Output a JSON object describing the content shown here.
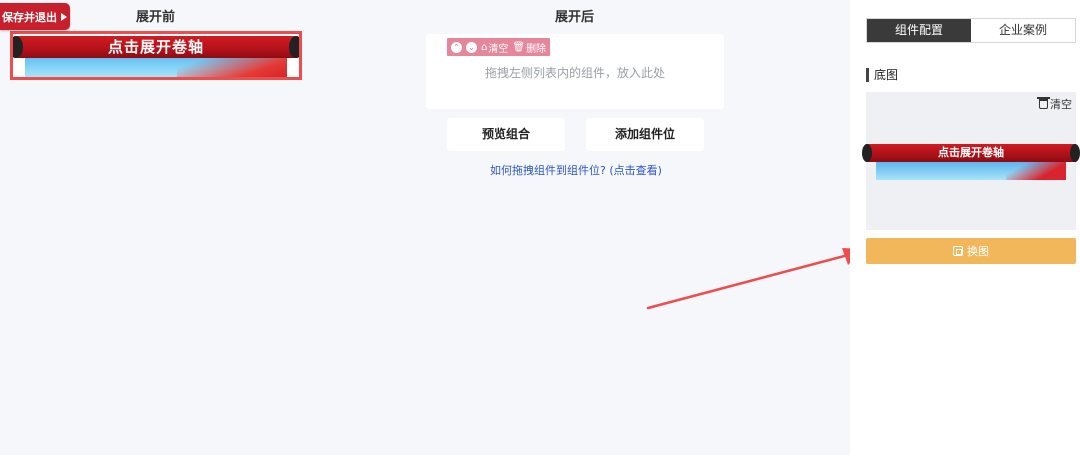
{
  "toolbar": {
    "save_label": "保存并退出"
  },
  "before": {
    "title": "展开前",
    "banner_text": "点击展开卷轴"
  },
  "after": {
    "title": "展开后",
    "drop_toolbar": {
      "clear": "清空",
      "delete": "删除"
    },
    "drop_hint": "拖拽左侧列表内的组件，放入此处",
    "preview_btn": "预览组合",
    "add_slot_btn": "添加组件位",
    "help_link": "如何拖拽组件到组件位? (点击查看)"
  },
  "panel": {
    "tabs": [
      {
        "label": "组件配置",
        "active": true
      },
      {
        "label": "企业案例",
        "active": false
      }
    ],
    "section_title": "底图",
    "clear_label": "清空",
    "banner_text": "点击展开卷轴",
    "swap_label": "换图"
  },
  "colors": {
    "brand_red": "#c71f2b",
    "highlight": "#ef4d4d",
    "toolbar_pink": "#e6869b",
    "swap_orange": "#f2b75a",
    "link_blue": "#2b56c8"
  },
  "icons": [
    "play-triangle-icon",
    "collapse-up-icon",
    "collapse-down-icon",
    "clear-icon",
    "trash-icon",
    "swap-image-icon"
  ]
}
